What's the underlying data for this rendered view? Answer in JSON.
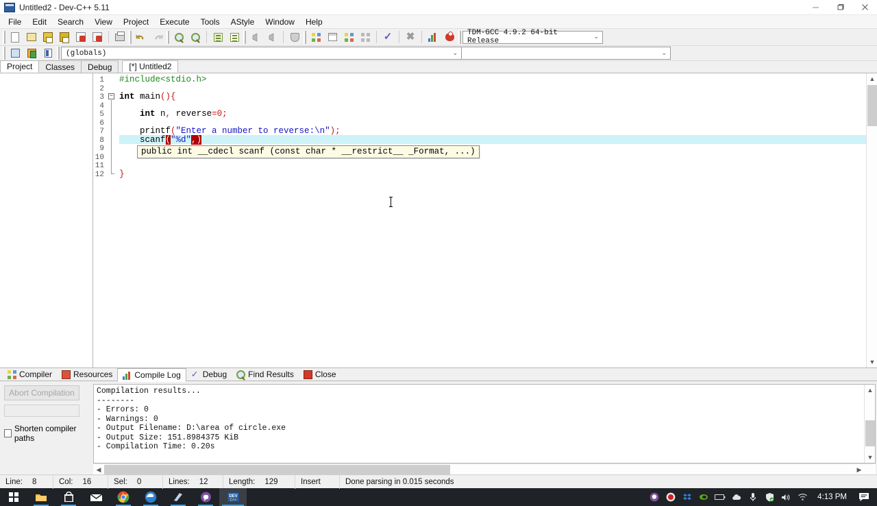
{
  "window": {
    "title": "Untitled2 - Dev-C++ 5.11",
    "app_icon": "devcpp-icon",
    "controls": {
      "minimize": "–",
      "maximize": "❐",
      "close": "✕"
    }
  },
  "menubar": [
    "File",
    "Edit",
    "Search",
    "View",
    "Project",
    "Execute",
    "Tools",
    "AStyle",
    "Window",
    "Help"
  ],
  "toolbar": {
    "icons": [
      "new-file-icon",
      "open-file-icon",
      "save-icon",
      "save-all-icon",
      "close-file-icon",
      "close-all-icon",
      "print-icon",
      "undo-icon",
      "redo-icon",
      "find-icon",
      "replace-icon",
      "goto-line-icon",
      "goto-function-icon",
      "back-icon",
      "forward-icon",
      "toggle-bookmark-icon",
      "compile-icon",
      "run-icon",
      "compile-and-run-icon",
      "rebuild-all-icon",
      "syntax-check-icon",
      "stop-execution-icon",
      "profile-icon",
      "debug-icon"
    ],
    "compiler_select": "TDM-GCC 4.9.2 64-bit Release",
    "caret": "⌄"
  },
  "toolbar2": {
    "icons": [
      "insert-icon",
      "toggle-icon",
      "goto-class-icon"
    ],
    "scope_select": "(globals)",
    "caret": "⌄"
  },
  "panel_tabs": [
    {
      "label": "Project",
      "active": true
    },
    {
      "label": "Classes",
      "active": false
    },
    {
      "label": "Debug",
      "active": false
    }
  ],
  "editor_tabs": [
    {
      "label": "[*] Untitled2",
      "active": true
    }
  ],
  "editor": {
    "line_numbers": [
      "1",
      "2",
      "3",
      "4",
      "5",
      "6",
      "7",
      "8",
      "9",
      "10",
      "11",
      "12"
    ],
    "fold_marker": "−",
    "active_line": 8,
    "lines": [
      {
        "n": 1,
        "tokens": [
          {
            "t": "#include<stdio.h>",
            "c": "tok-pre"
          }
        ]
      },
      {
        "n": 2,
        "tokens": []
      },
      {
        "n": 3,
        "tokens": [
          {
            "t": "int",
            "c": "tok-kw"
          },
          {
            "t": " main",
            "c": "tok-id"
          },
          {
            "t": "(){",
            "c": "tok-sym"
          }
        ]
      },
      {
        "n": 4,
        "tokens": []
      },
      {
        "n": 5,
        "tokens": [
          {
            "t": "    ",
            "c": "tok-id"
          },
          {
            "t": "int",
            "c": "tok-kw"
          },
          {
            "t": " n",
            "c": "tok-id"
          },
          {
            "t": ",",
            "c": "tok-sym"
          },
          {
            "t": " reverse",
            "c": "tok-id"
          },
          {
            "t": "=",
            "c": "tok-sym"
          },
          {
            "t": "0",
            "c": "tok-num"
          },
          {
            "t": ";",
            "c": "tok-sym"
          }
        ]
      },
      {
        "n": 6,
        "tokens": []
      },
      {
        "n": 7,
        "tokens": [
          {
            "t": "    printf",
            "c": "tok-id"
          },
          {
            "t": "(",
            "c": "tok-sym"
          },
          {
            "t": "\"Enter a number to reverse:\\n\"",
            "c": "tok-str"
          },
          {
            "t": ")",
            "c": "tok-sym"
          },
          {
            "t": ";",
            "c": "tok-sym"
          }
        ]
      },
      {
        "n": 8,
        "tokens": [
          {
            "t": "    scanf",
            "c": "tok-id"
          },
          {
            "t": "(",
            "c": "tok-brace-hl"
          },
          {
            "t": "\"%d\"",
            "c": "tok-str"
          },
          {
            "t": ",",
            "c": "tok-sym"
          },
          {
            "t": ")",
            "c": "tok-brace-hl"
          }
        ]
      },
      {
        "n": 9,
        "tokens": []
      },
      {
        "n": 10,
        "tokens": []
      },
      {
        "n": 11,
        "tokens": []
      },
      {
        "n": 12,
        "tokens": [
          {
            "t": "}",
            "c": "tok-sym"
          }
        ]
      }
    ],
    "tooltip": "public int __cdecl scanf (const char * __restrict__ _Format, ...)"
  },
  "bottom_tabs": [
    {
      "label": "Compiler",
      "icon": "compiler-icon",
      "active": false
    },
    {
      "label": "Resources",
      "icon": "resources-icon",
      "active": false
    },
    {
      "label": "Compile Log",
      "icon": "compile-log-icon",
      "active": true
    },
    {
      "label": "Debug",
      "icon": "debug-check-icon",
      "active": false
    },
    {
      "label": "Find Results",
      "icon": "find-results-icon",
      "active": false
    },
    {
      "label": "Close",
      "icon": "close-panel-icon",
      "active": false
    }
  ],
  "bottom_left": {
    "abort_button": "Abort Compilation",
    "shorten_paths_label": "Shorten compiler paths",
    "shorten_paths_checked": false
  },
  "compile_log": "Compilation results...\n--------\n- Errors: 0\n- Warnings: 0\n- Output Filename: D:\\area of circle.exe\n- Output Size: 151.8984375 KiB\n- Compilation Time: 0.20s",
  "statusbar": [
    {
      "label": "Line:",
      "value": "8"
    },
    {
      "label": "Col:",
      "value": "16"
    },
    {
      "label": "Sel:",
      "value": "0"
    },
    {
      "label": "Lines:",
      "value": "12"
    },
    {
      "label": "Length:",
      "value": "129"
    },
    {
      "label": "Insert",
      "value": ""
    },
    {
      "label": "Done parsing in 0.015 seconds",
      "value": ""
    }
  ],
  "taskbar": {
    "start": "windows-start-icon",
    "items": [
      "file-explorer-icon",
      "microsoft-store-icon",
      "mail-icon",
      "google-chrome-icon",
      "microsoft-edge-icon",
      "notepad-icon",
      "viber-icon",
      "devcpp-taskbar-icon"
    ],
    "tray": [
      "viber-tray-icon",
      "record-icon",
      "dropbox-icon",
      "nvidia-icon",
      "battery-icon",
      "onedrive-icon",
      "microphone-icon",
      "security-icon",
      "volume-icon",
      "wifi-icon"
    ],
    "clock": "4:13 PM",
    "notifications": "action-center-icon"
  },
  "colors": {
    "accent": "#3ea0e8",
    "active_line": "#cdf2f7",
    "brace_match": "#b00000",
    "string": "#1414c8",
    "preprocessor": "#1a8a1a",
    "number": "#c81414",
    "tooltip_bg": "#fdfbe4"
  }
}
